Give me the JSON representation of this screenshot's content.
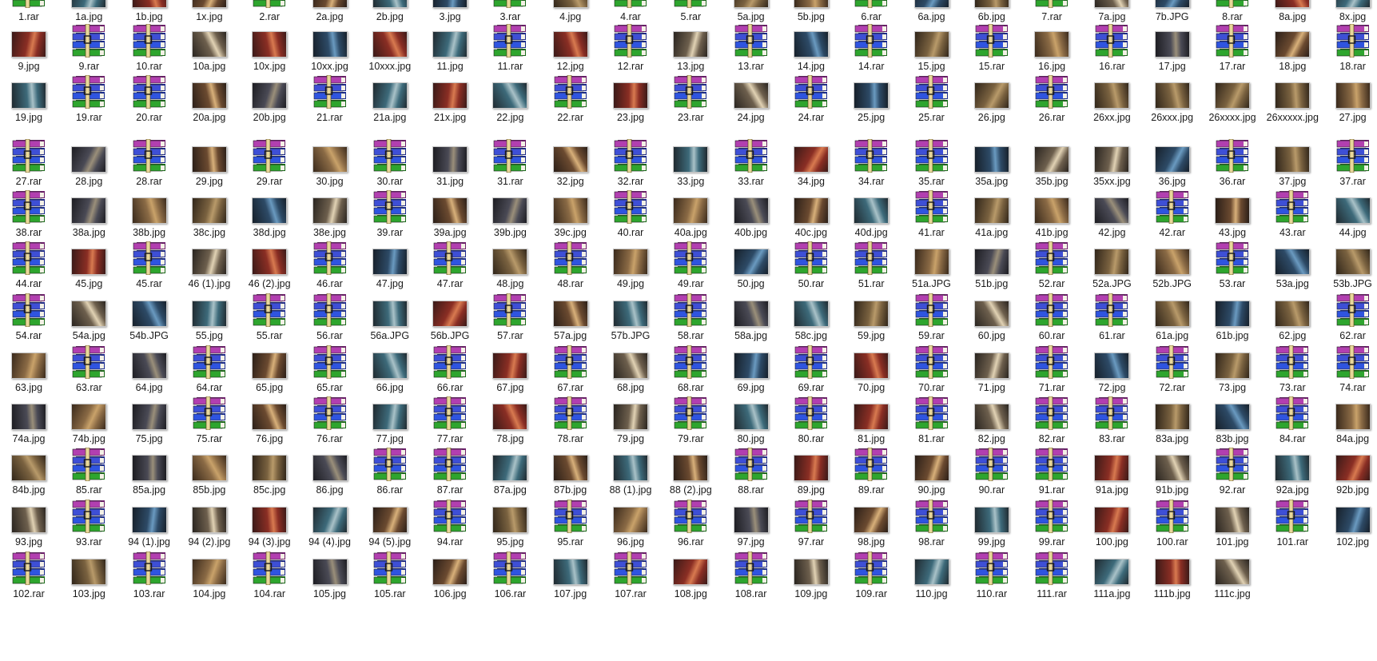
{
  "window": {
    "view": "Large icons"
  },
  "colors": {
    "background": "#ffffff",
    "label": "#1a1a1a"
  },
  "icons": {
    "archive": "winrar-archive-icon",
    "image": "image-thumbnail-icon"
  },
  "rows": [
    [
      "1.rar",
      "1a.jpg",
      "1b.jpg",
      "1x.jpg",
      "2.rar",
      "2a.jpg",
      "2b.jpg",
      "3.jpg",
      "3.rar",
      "4.jpg",
      "4.rar",
      "5.rar",
      "5a.jpg",
      "5b.jpg",
      "6.rar",
      "6a.jpg",
      "6b.jpg",
      "7.rar",
      "7a.jpg",
      "7b.JPG",
      "8.rar",
      "8a.jpg",
      "8x.jpg"
    ],
    [
      "9.jpg",
      "9.rar",
      "10.rar",
      "10a.jpg",
      "10x.jpg",
      "10xx.jpg",
      "10xxx.jpg",
      "11.jpg",
      "11.rar",
      "12.jpg",
      "12.rar",
      "13.jpg",
      "13.rar",
      "14.jpg",
      "14.rar",
      "15.jpg",
      "15.rar",
      "16.jpg",
      "16.rar",
      "17.jpg",
      "17.rar",
      "18.jpg",
      "18.rar"
    ],
    [
      "19.jpg",
      "19.rar",
      "20.rar",
      "20a.jpg",
      "20b.jpg",
      "21.rar",
      "21a.jpg",
      "21x.jpg",
      "22.jpg",
      "22.rar",
      "23.jpg",
      "23.rar",
      "24.jpg",
      "24.rar",
      "25.jpg",
      "25.rar",
      "26.jpg",
      "26.rar",
      "26xx.jpg",
      "26xxx.jpg",
      "26xxxx.jpg",
      "26xxxxx.jpg",
      "27.jpg"
    ],
    [
      "27.rar",
      "28.jpg",
      "28.rar",
      "29.jpg",
      "29.rar",
      "30.jpg",
      "30.rar",
      "31.jpg",
      "31.rar",
      "32.jpg",
      "32.rar",
      "33.jpg",
      "33.rar",
      "34.jpg",
      "34.rar",
      "35.rar",
      "35a.jpg",
      "35b.jpg",
      "35xx.jpg",
      "36.jpg",
      "36.rar",
      "37.jpg",
      "37.rar"
    ],
    [
      "38.rar",
      "38a.jpg",
      "38b.jpg",
      "38c.jpg",
      "38d.jpg",
      "38e.jpg",
      "39.rar",
      "39a.jpg",
      "39b.jpg",
      "39c.jpg",
      "40.rar",
      "40a.jpg",
      "40b.jpg",
      "40c.jpg",
      "40d.jpg",
      "41.rar",
      "41a.jpg",
      "41b.jpg",
      "42.jpg",
      "42.rar",
      "43.jpg",
      "43.rar",
      "44.jpg"
    ],
    [
      "44.rar",
      "45.jpg",
      "45.rar",
      "46 (1).jpg",
      "46 (2).jpg",
      "46.rar",
      "47.jpg",
      "47.rar",
      "48.jpg",
      "48.rar",
      "49.jpg",
      "49.rar",
      "50.jpg",
      "50.rar",
      "51.rar",
      "51a.JPG",
      "51b.jpg",
      "52.rar",
      "52a.JPG",
      "52b.JPG",
      "53.rar",
      "53a.jpg",
      "53b.JPG"
    ],
    [
      "54.rar",
      "54a.jpg",
      "54b.JPG",
      "55.jpg",
      "55.rar",
      "56.rar",
      "56a.JPG",
      "56b.JPG",
      "57.rar",
      "57a.jpg",
      "57b.JPG",
      "58.rar",
      "58a.jpg",
      "58c.jpg",
      "59.jpg",
      "59.rar",
      "60.jpg",
      "60.rar",
      "61.rar",
      "61a.jpg",
      "61b.jpg",
      "62.jpg",
      "62.rar"
    ],
    [
      "63.jpg",
      "63.rar",
      "64.jpg",
      "64.rar",
      "65.jpg",
      "65.rar",
      "66.jpg",
      "66.rar",
      "67.jpg",
      "67.rar",
      "68.jpg",
      "68.rar",
      "69.jpg",
      "69.rar",
      "70.jpg",
      "70.rar",
      "71.jpg",
      "71.rar",
      "72.jpg",
      "72.rar",
      "73.jpg",
      "73.rar",
      "74.rar"
    ],
    [
      "74a.jpg",
      "74b.jpg",
      "75.jpg",
      "75.rar",
      "76.jpg",
      "76.rar",
      "77.jpg",
      "77.rar",
      "78.jpg",
      "78.rar",
      "79.jpg",
      "79.rar",
      "80.jpg",
      "80.rar",
      "81.jpg",
      "81.rar",
      "82.jpg",
      "82.rar",
      "83.rar",
      "83a.jpg",
      "83b.jpg",
      "84.rar",
      "84a.jpg"
    ],
    [
      "84b.jpg",
      "85.rar",
      "85a.jpg",
      "85b.jpg",
      "85c.jpg",
      "86.jpg",
      "86.rar",
      "87.rar",
      "87a.jpg",
      "87b.jpg",
      "88 (1).jpg",
      "88 (2).jpg",
      "88.rar",
      "89.jpg",
      "89.rar",
      "90.jpg",
      "90.rar",
      "91.rar",
      "91a.jpg",
      "91b.jpg",
      "92.rar",
      "92a.jpg",
      "92b.jpg"
    ],
    [
      "93.jpg",
      "93.rar",
      "94 (1).jpg",
      "94 (2).jpg",
      "94 (3).jpg",
      "94 (4).jpg",
      "94 (5).jpg",
      "94.rar",
      "95.jpg",
      "95.rar",
      "96.jpg",
      "96.rar",
      "97.jpg",
      "97.rar",
      "98.jpg",
      "98.rar",
      "99.jpg",
      "99.rar",
      "100.jpg",
      "100.rar",
      "101.jpg",
      "101.rar",
      "102.jpg"
    ],
    [
      "102.rar",
      "103.jpg",
      "103.rar",
      "104.jpg",
      "104.rar",
      "105.jpg",
      "105.rar",
      "106.jpg",
      "106.rar",
      "107.jpg",
      "107.rar",
      "108.jpg",
      "108.rar",
      "109.jpg",
      "109.rar",
      "110.jpg",
      "110.rar",
      "111.rar",
      "111a.jpg",
      "111b.jpg",
      "111c.jpg"
    ]
  ]
}
